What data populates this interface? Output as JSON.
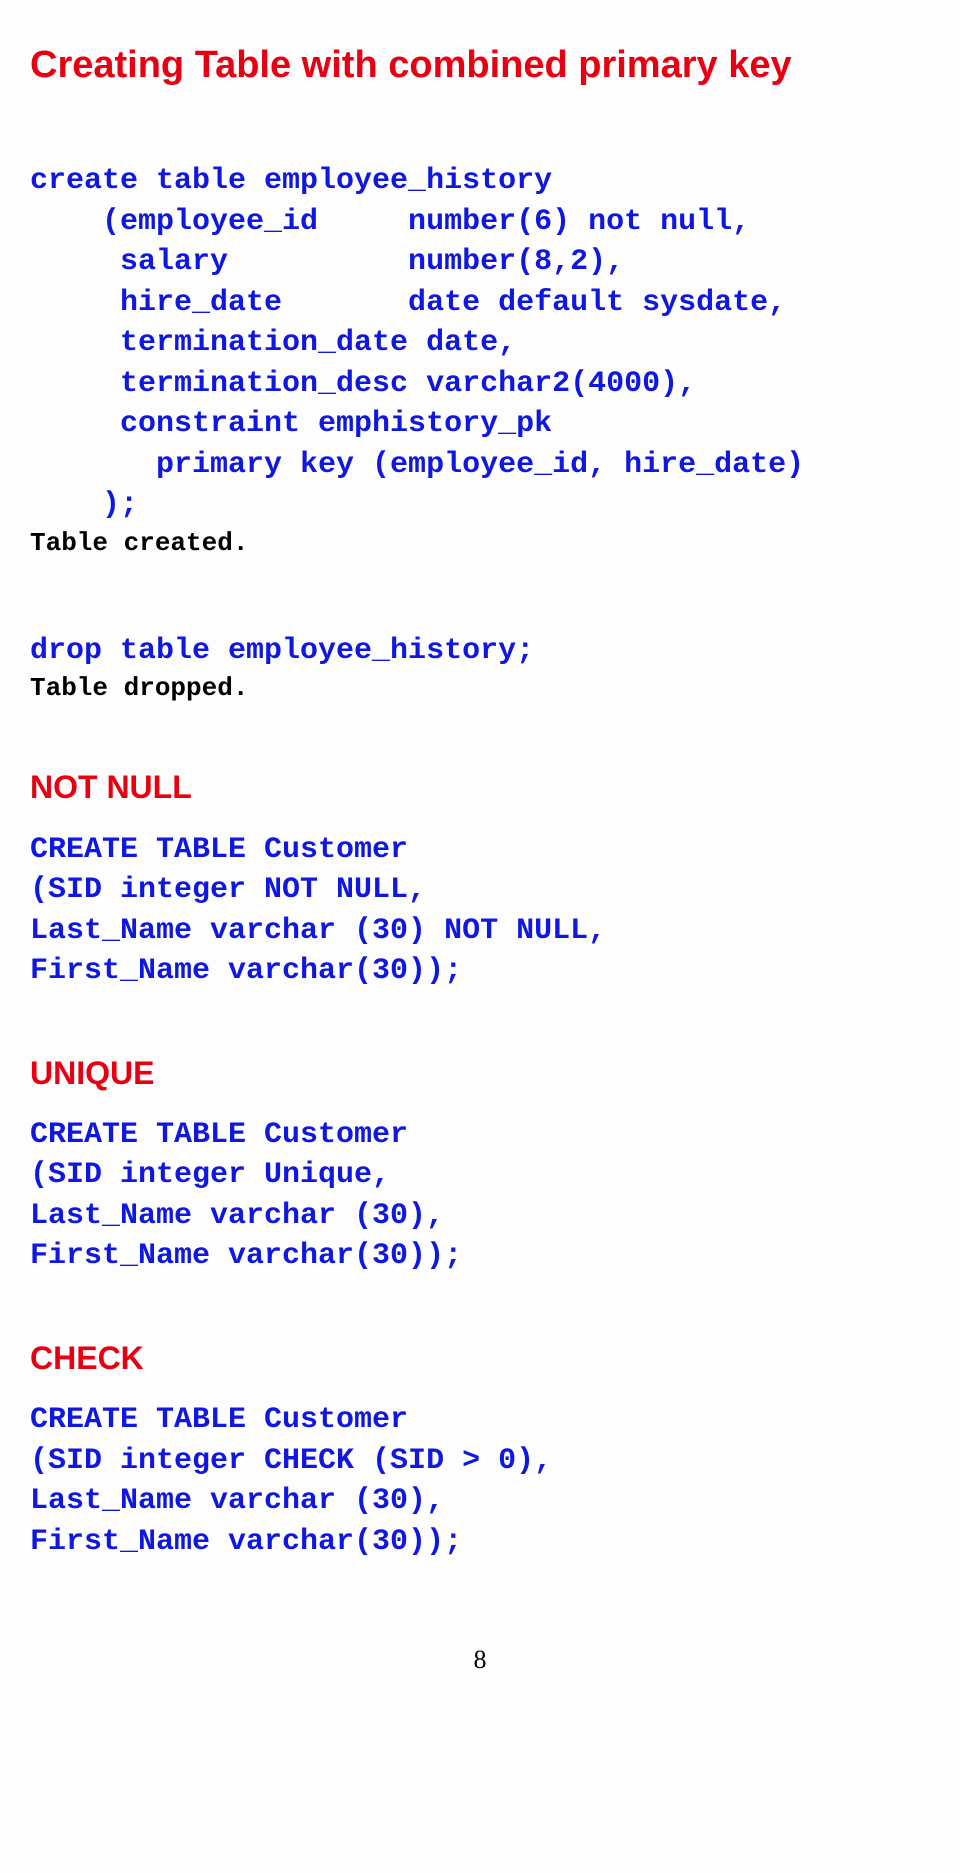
{
  "title": "Creating Table with combined primary key",
  "code1": "create table employee_history\n    (employee_id     number(6) not null,\n     salary          number(8,2),\n     hire_date       date default sysdate,\n     termination_date date,\n     termination_desc varchar2(4000),\n     constraint emphistory_pk\n       primary key (employee_id, hire_date)\n    );",
  "result1": "Table created.",
  "code2": "drop table employee_history;",
  "result2": "Table dropped.",
  "h_notnull": "NOT NULL",
  "code3": "CREATE TABLE Customer\n(SID integer NOT NULL,\nLast_Name varchar (30) NOT NULL,\nFirst_Name varchar(30));",
  "h_unique": "UNIQUE",
  "code4": "CREATE TABLE Customer\n(SID integer Unique,\nLast_Name varchar (30),\nFirst_Name varchar(30));",
  "h_check": "CHECK",
  "code5": "CREATE TABLE Customer\n(SID integer CHECK (SID > 0),\nLast_Name varchar (30),\nFirst_Name varchar(30));",
  "pagenum": "8"
}
